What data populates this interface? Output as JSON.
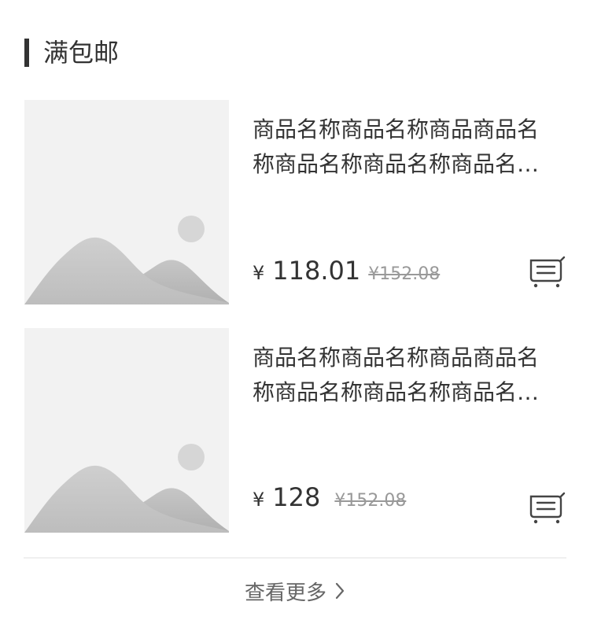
{
  "section": {
    "title": "满包邮"
  },
  "products": [
    {
      "name": "商品名称商品名称商品商品名称商品名称商品名称商品名称商品名称",
      "currency": "¥",
      "price": "118.01",
      "original_price": "¥152.08",
      "image_icon": "image-placeholder-icon",
      "cart_icon": "cart-icon"
    },
    {
      "name": "商品名称商品名称商品商品名称商品名称商品名称商品名称商品名称",
      "currency": "¥",
      "price": "128",
      "original_price": "¥152.08",
      "image_icon": "image-placeholder-icon",
      "cart_icon": "cart-icon"
    }
  ],
  "footer": {
    "view_more_label": "查看更多",
    "view_more_icon": "chevron-right-icon"
  },
  "colors": {
    "text": "#333333",
    "muted": "#999999",
    "placeholder_bg": "#f2f2f2",
    "divider": "#f0f0f0"
  }
}
